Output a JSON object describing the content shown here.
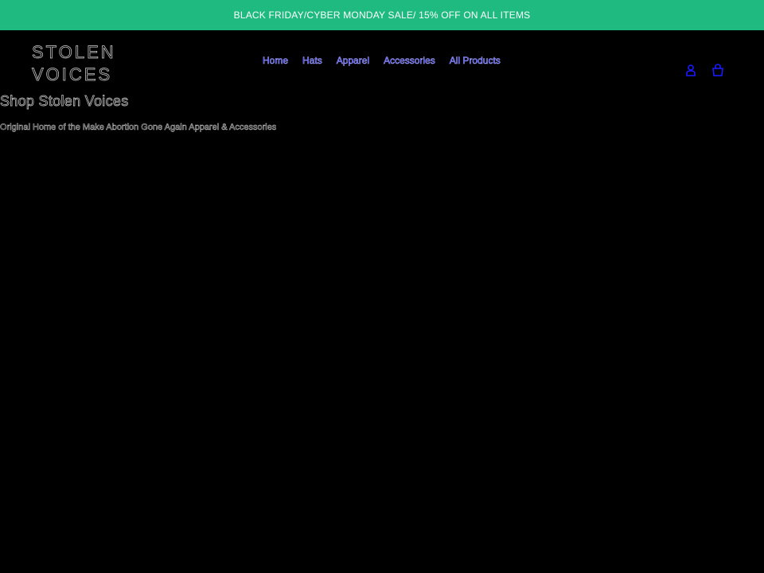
{
  "announcement": {
    "text": "BLACK FRIDAY/CYBER MONDAY SALE/ 15% OFF ON ALL ITEMS",
    "background": "#1fba7f"
  },
  "logo": {
    "line1": "STOLEN",
    "line2": "VOICES"
  },
  "nav": {
    "items": [
      {
        "label": "Home"
      },
      {
        "label": "Hats"
      },
      {
        "label": "Apparel"
      },
      {
        "label": "Accessories"
      },
      {
        "label": "All Products"
      }
    ],
    "color": "#1a1aff"
  },
  "header_icons": {
    "account": "account-icon",
    "cart": "cart-icon"
  },
  "main": {
    "title": "Shop Stolen Voices",
    "subtitle": "Original Home of the Make Abortion Gone Again Apparel & Accessories"
  }
}
